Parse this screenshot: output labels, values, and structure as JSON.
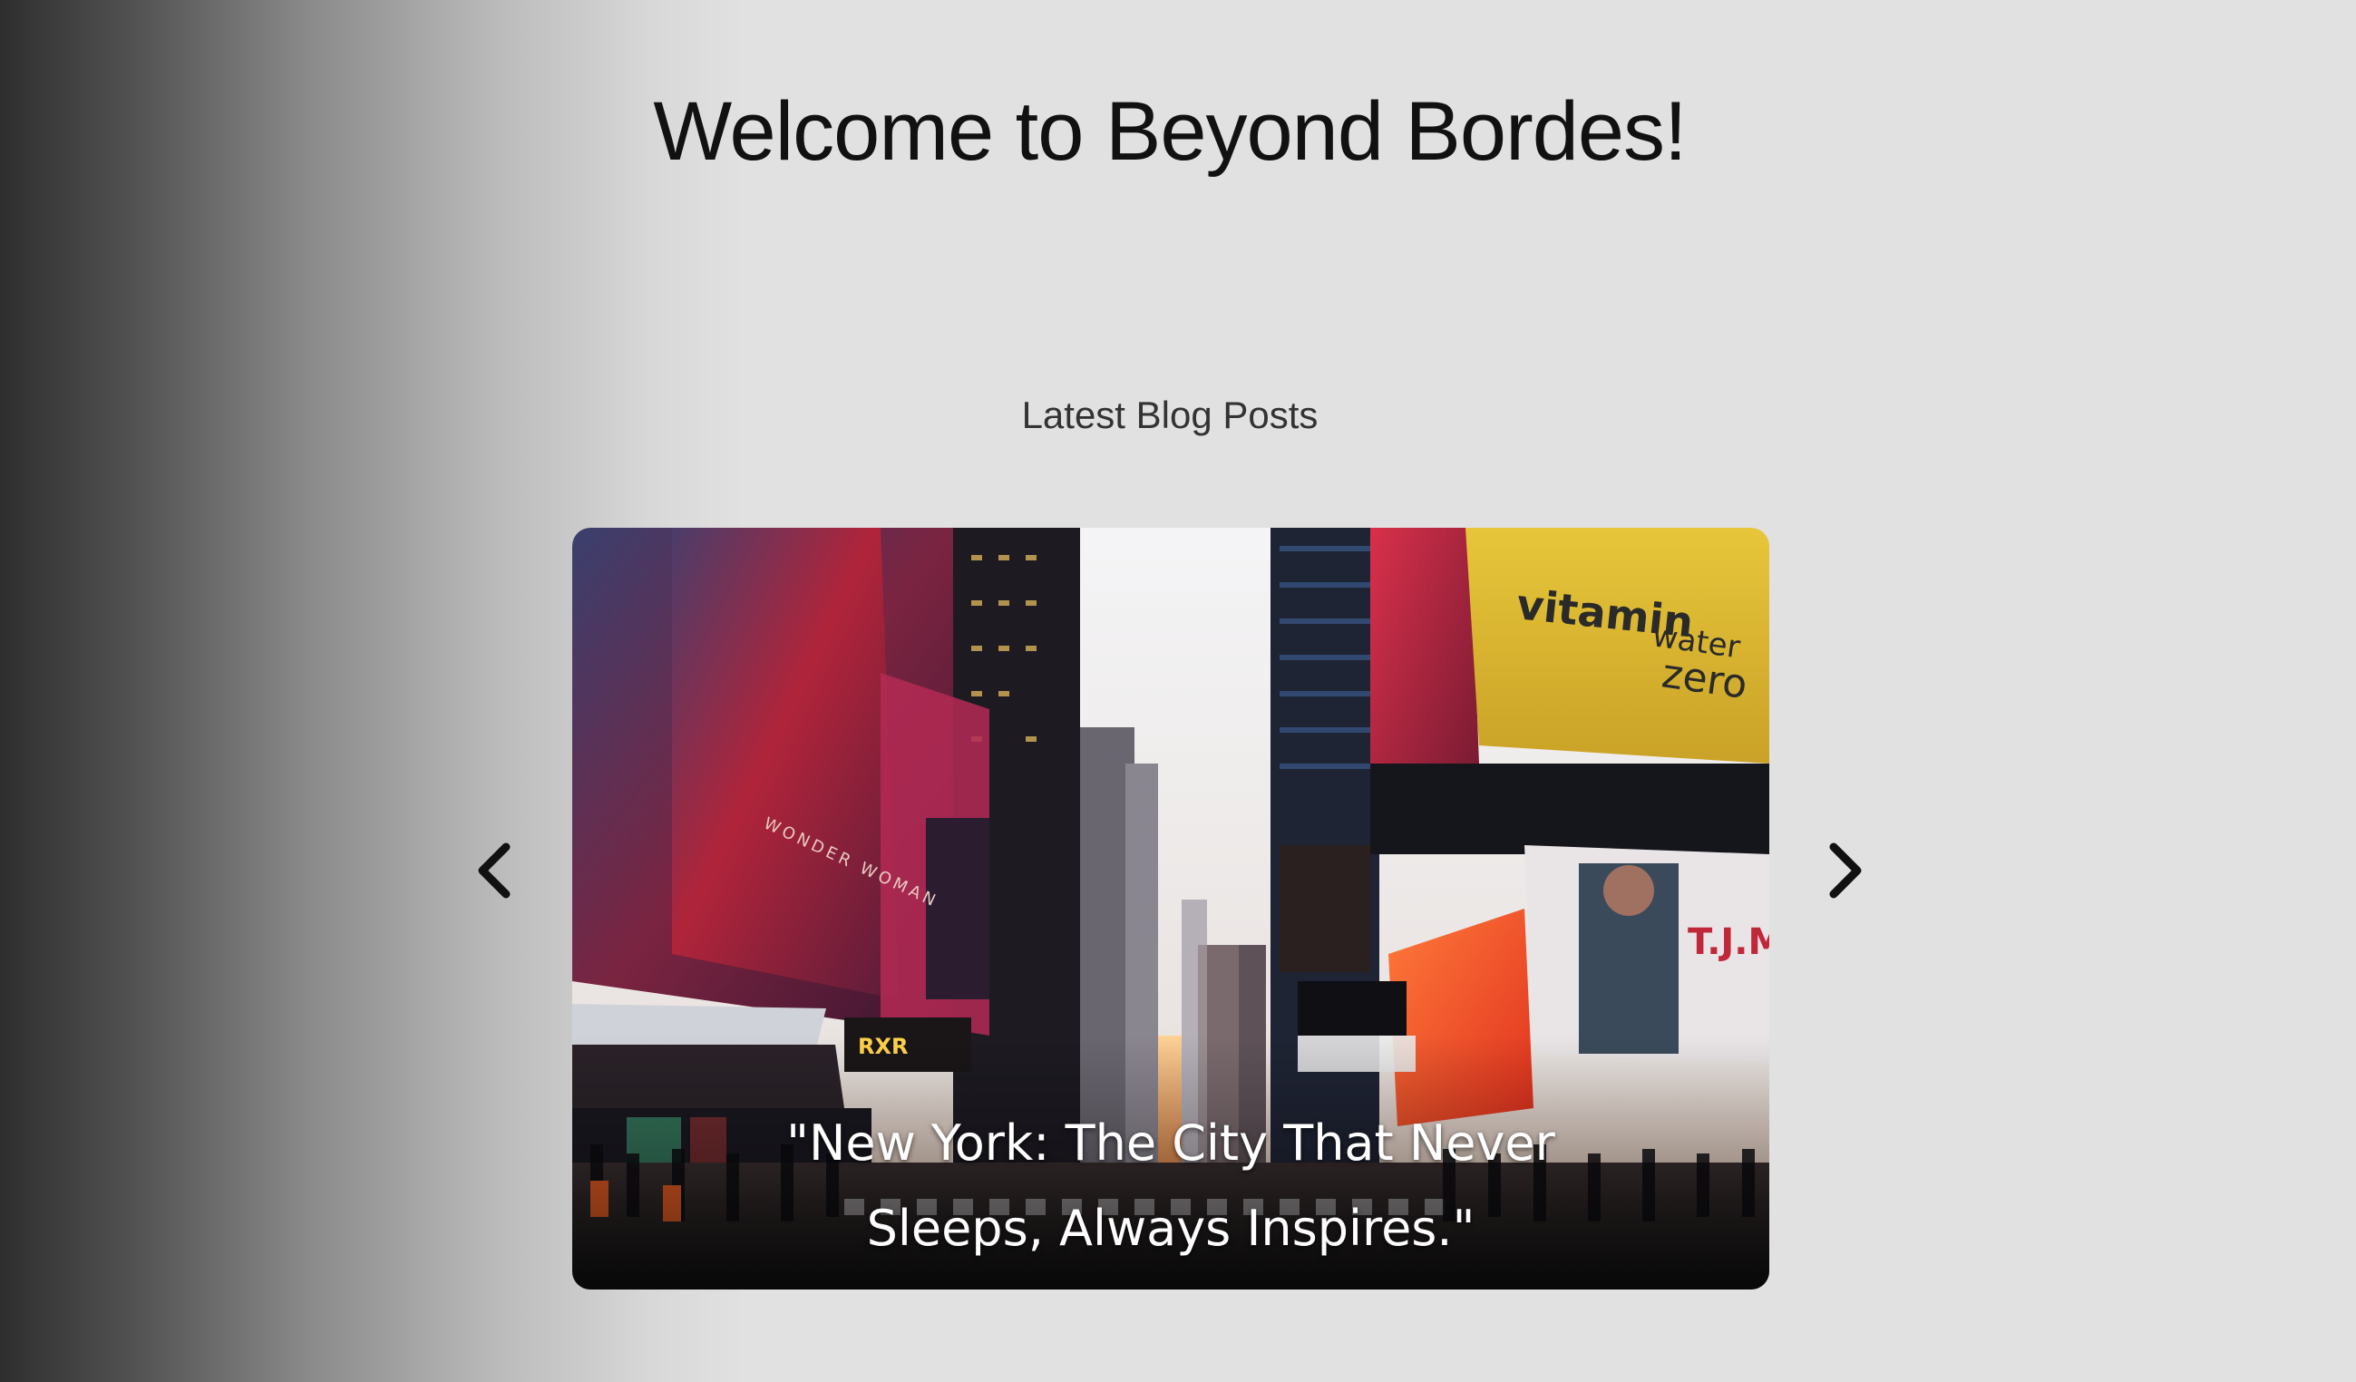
{
  "header": {
    "title": "Welcome to Beyond Bordes!"
  },
  "blog": {
    "section_title": "Latest Blog Posts",
    "carousel": {
      "prev_icon": "chevron-left-icon",
      "next_icon": "chevron-right-icon",
      "current_slide": {
        "caption": "\"New York: The City That Never Sleeps, Always Inspires.\""
      }
    }
  },
  "colors": {
    "page_background": "#e1e1e1",
    "left_gradient_dark": "#2e2e2e",
    "title_text": "#111111",
    "section_text": "#333333",
    "caption_text": "#ffffff"
  }
}
